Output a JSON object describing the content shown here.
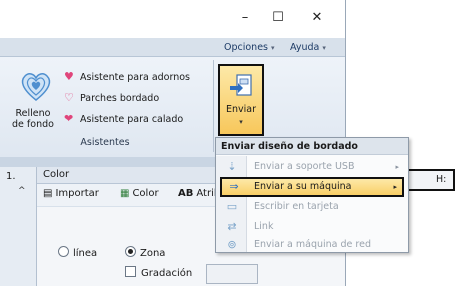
{
  "window": {
    "minimize_glyph": "–",
    "maximize_glyph": "☐",
    "close_glyph": "✕"
  },
  "menu": {
    "options": "Opciones",
    "help": "Ayuda",
    "caret": "▾"
  },
  "ribbon": {
    "relleno_label_line1": "Relleno",
    "relleno_label_line2": "de fondo",
    "items": [
      {
        "label": "Asistente para adornos",
        "icon": "heart-icon"
      },
      {
        "label": "Parches bordado",
        "icon": "heart-outline-icon"
      },
      {
        "label": "Asistente para calado",
        "icon": "lace-heart-icon"
      }
    ],
    "group_label": "Asistentes",
    "enviar_label": "Enviar",
    "enviar_arrow": "▾"
  },
  "dropdown": {
    "header": "Enviar diseño de bordado",
    "items": [
      {
        "label": "Enviar a soporte USB",
        "enabled": false,
        "submenu": true,
        "icon": "usb-icon"
      },
      {
        "label": "Enviar a su máquina",
        "enabled": true,
        "submenu": true,
        "active": true,
        "icon": "send-machine-icon"
      },
      {
        "label": "Escribir en tarjeta",
        "enabled": false,
        "submenu": false,
        "icon": "card-icon"
      },
      {
        "label": "Link",
        "enabled": false,
        "submenu": false,
        "icon": "link-icon"
      },
      {
        "label": "Enviar a máquina de red",
        "enabled": false,
        "submenu": false,
        "icon": "network-icon"
      }
    ],
    "submenu_glyph": "▸"
  },
  "panel": {
    "left_number": "1.",
    "left_arrow": "^",
    "title": "Color",
    "tabs": [
      {
        "label": "Importar",
        "icon": "import-icon"
      },
      {
        "label": "Color",
        "icon": "color-icon"
      },
      {
        "label": "Atrib",
        "icon": "ab-icon",
        "prefix": "AB"
      }
    ],
    "radio_line": "línea",
    "radio_zone": "Zona",
    "checkbox_gradient": "Gradación"
  },
  "right_fragment": {
    "label": "H:"
  },
  "colors": {
    "accent_yellow": "#f9cf67",
    "ribbon_bg": "#e4ebf4",
    "heart_pink": "#e0457b"
  }
}
